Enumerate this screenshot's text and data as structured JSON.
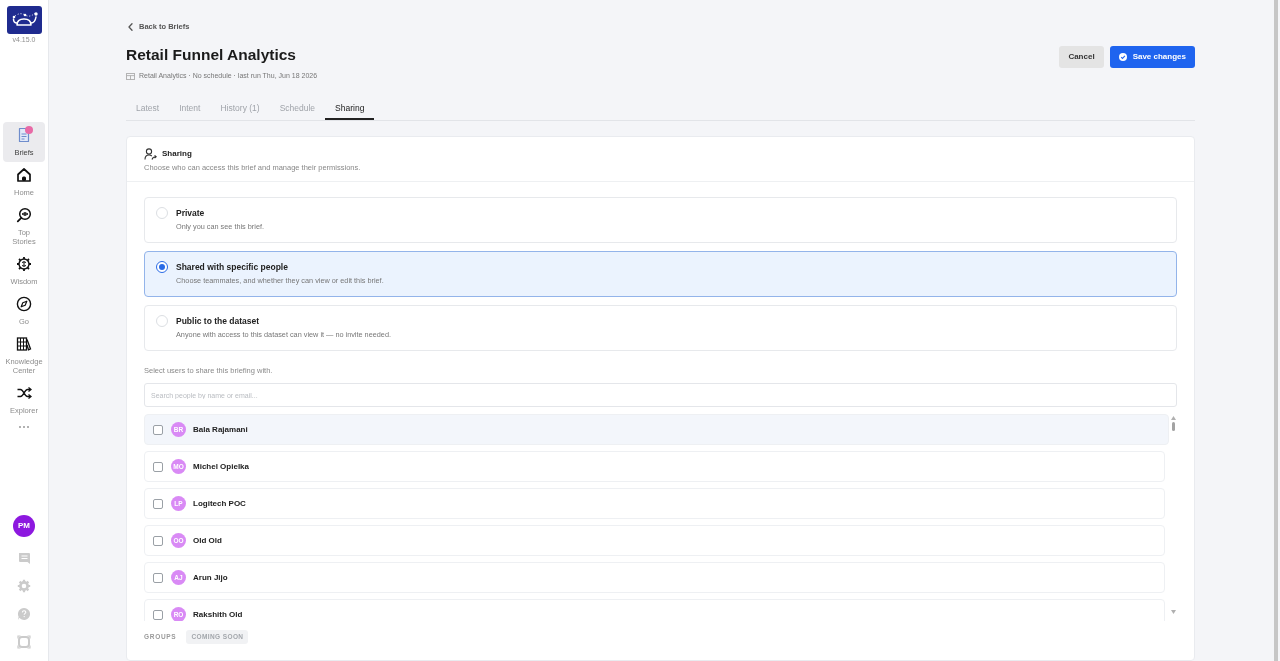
{
  "sidebar": {
    "version": "v4.15.0",
    "items": [
      {
        "kind": "briefs",
        "label": "Briefs",
        "selected": true,
        "badge": true
      },
      {
        "kind": "home",
        "label": "Home",
        "selected": false,
        "badge": false
      },
      {
        "kind": "top_stories",
        "label": "Top Stories",
        "selected": false,
        "badge": false
      },
      {
        "kind": "wisdom",
        "label": "Wisdom",
        "selected": false,
        "badge": false
      },
      {
        "kind": "go",
        "label": "Go",
        "selected": false,
        "badge": false
      },
      {
        "kind": "knowledge",
        "label": "Knowledge Center",
        "selected": false,
        "badge": false
      },
      {
        "kind": "explorer",
        "label": "Explorer",
        "selected": false,
        "badge": false
      }
    ],
    "user_initials": "PM"
  },
  "header": {
    "back_link": "Back to Briefs",
    "title": "Retail Funnel Analytics",
    "meta": "Retail Analytics · No schedule · last run Thu, Jun 18 2026",
    "buttons": [
      {
        "kind": "secondary",
        "label": "Cancel"
      },
      {
        "kind": "primary",
        "label": "Save changes"
      }
    ]
  },
  "tabs": [
    {
      "label": "Latest",
      "selected": false
    },
    {
      "label": "Intent",
      "selected": false
    },
    {
      "label": "History (1)",
      "selected": false
    },
    {
      "label": "Schedule",
      "selected": false
    },
    {
      "label": "Sharing",
      "selected": true
    }
  ],
  "sharing": {
    "title": "Sharing",
    "subtitle": "Choose who can access this brief and manage their permissions.",
    "options": [
      {
        "title": "Private",
        "description": "Only you can see this brief.",
        "selected": false
      },
      {
        "title": "Shared with specific people",
        "description": "Choose teammates, and whether they can view or edit this brief.",
        "selected": true
      },
      {
        "title": "Public to the dataset",
        "description": "Anyone with access to this dataset can view it — no invite needed.",
        "selected": false
      }
    ],
    "users_prompt": "Select users to share this briefing with.",
    "search": {
      "placeholder": "Search people by name or email..."
    },
    "users": [
      {
        "initials": "BR",
        "name": "Bala Rajamani",
        "checked": false,
        "hovered": true
      },
      {
        "initials": "MO",
        "name": "Michel Opielka",
        "checked": false,
        "hovered": false
      },
      {
        "initials": "LP",
        "name": "Logitech POC",
        "checked": false,
        "hovered": false
      },
      {
        "initials": "OO",
        "name": "Old Old",
        "checked": false,
        "hovered": false
      },
      {
        "initials": "AJ",
        "name": "Arun Jijo",
        "checked": false,
        "hovered": false
      },
      {
        "initials": "RO",
        "name": "Rakshith Old",
        "checked": false,
        "hovered": false
      }
    ],
    "groups": {
      "label": "GROUPS",
      "badge": "COMING SOON"
    }
  }
}
